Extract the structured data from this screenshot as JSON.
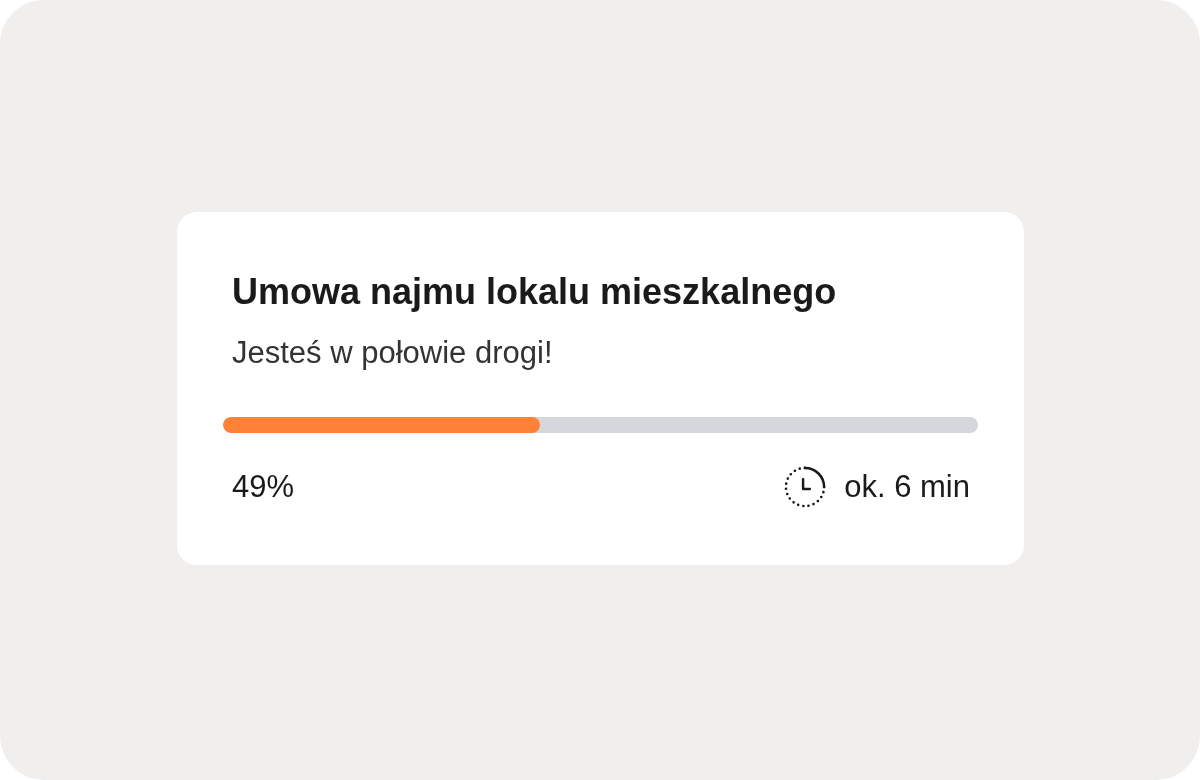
{
  "card": {
    "title": "Umowa najmu lokalu mieszkalnego",
    "subtitle": "Jesteś w połowie drogi!",
    "progress": {
      "level": 0.42
    },
    "percent": "49%",
    "time_estimate": "ok. 6 min"
  }
}
